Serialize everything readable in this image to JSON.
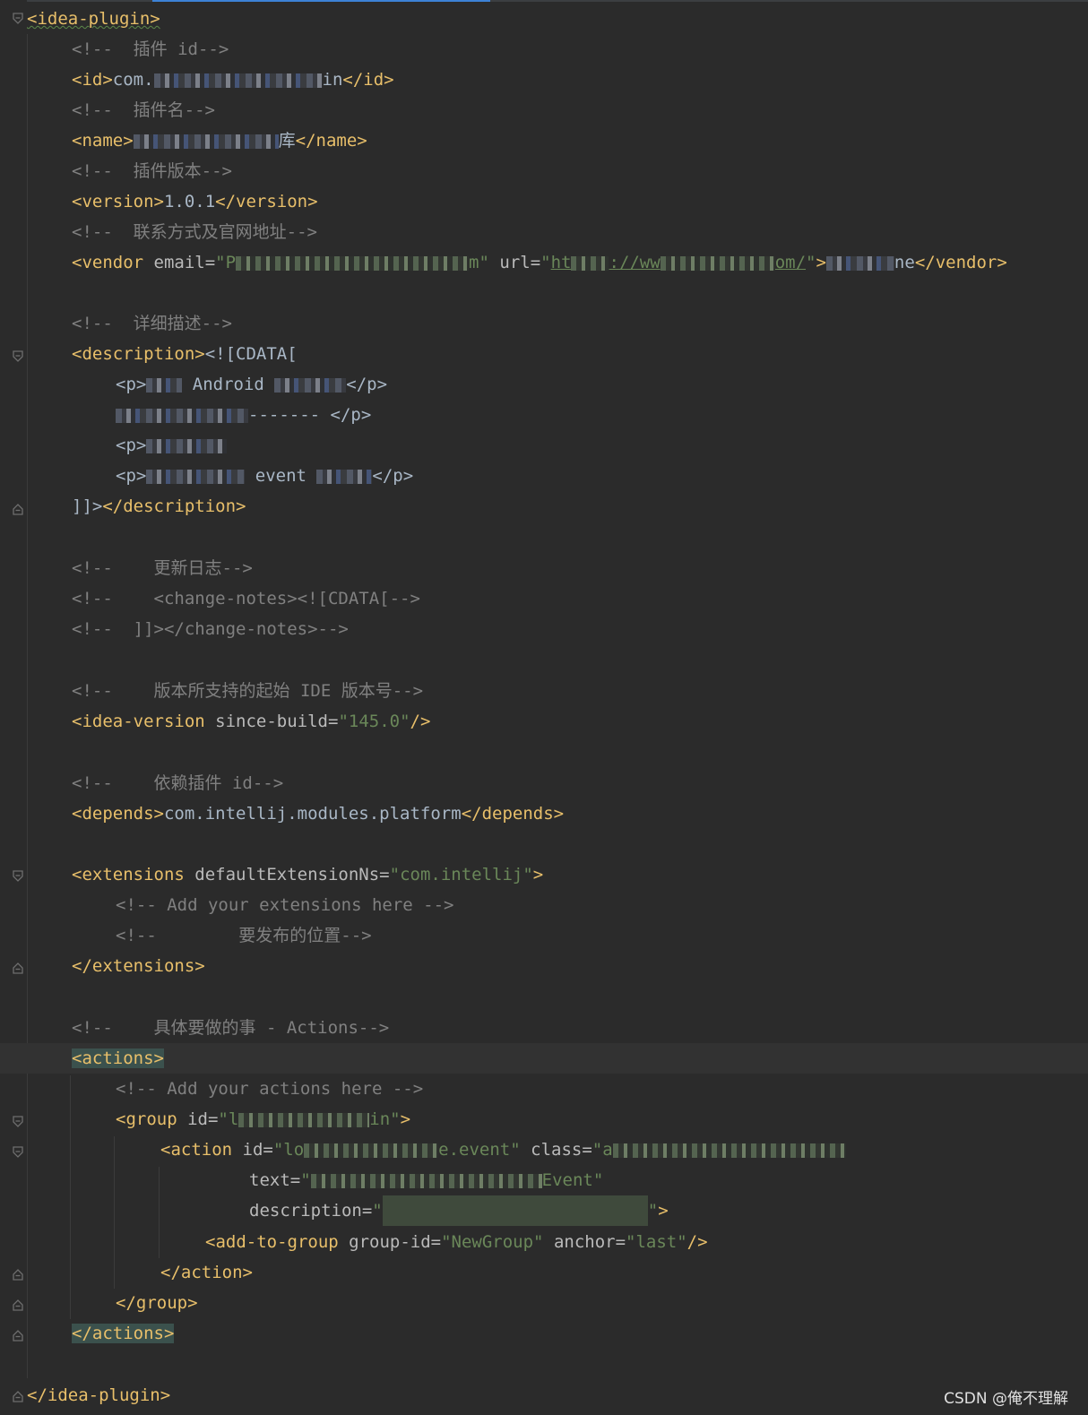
{
  "editor": {
    "root_open": "<idea-plugin>",
    "root_close": "</idea-plugin>",
    "c_id": "<!--  插件 id-->",
    "id_open": "<id>",
    "id_value_a": "com.",
    "id_value_b": "in",
    "id_close": "</id>",
    "c_name": "<!--  插件名-->",
    "name_open": "<name>",
    "name_value_b": "库",
    "name_close": "</name>",
    "c_version": "<!--  插件版本-->",
    "version_open": "<version>",
    "version_value": "1.0.1",
    "version_close": "</version>",
    "c_vendor": "<!--  联系方式及官网地址-->",
    "vendor_tag": "<vendor",
    "vendor_email_attr": " email=",
    "vendor_email_q1": "\"P",
    "vendor_email_q2": "m\"",
    "vendor_url_attr": " url=",
    "vendor_url_q1": "\"",
    "vendor_url_a": "ht",
    "vendor_url_b": "://ww",
    "vendor_url_c": "om/",
    "vendor_url_q2": "\"",
    "vendor_gt": ">",
    "vendor_text_b": "ne",
    "vendor_close": "</vendor>",
    "c_desc": "<!--  详细描述-->",
    "desc_open": "<description>",
    "cdata_open": "<![CDATA[",
    "p_open": "<p>",
    "p_close": "</p>",
    "desc_p1_text": " Android ",
    "desc_p2_text": "------- ",
    "desc_p2_close": "</p>",
    "desc_p4_text": " event ",
    "cdata_close": "]]>",
    "desc_close": "</description>",
    "c_changelog": "<!--    更新日志-->",
    "c_changenotes_open": "<!--    <change-notes><![CDATA[-->",
    "c_changenotes_close": "<!--  ]]></change-notes>-->",
    "c_ideaversion": "<!--    版本所支持的起始 IDE 版本号-->",
    "ideaversion_tag": "<idea-version",
    "ideaversion_attr": " since-build=",
    "ideaversion_value": "\"145.0\"",
    "ideaversion_end": "/>",
    "c_depends": "<!--    依赖插件 id-->",
    "depends_open": "<depends>",
    "depends_value": "com.intellij.modules.platform",
    "depends_close": "</depends>",
    "extensions_tag": "<extensions",
    "extensions_attr": " defaultExtensionNs=",
    "extensions_value": "\"com.intellij\"",
    "extensions_gt": ">",
    "c_add_ext": "<!-- Add your extensions here -->",
    "c_publish": "<!--        要发布的位置-->",
    "extensions_close": "</extensions>",
    "c_actions": "<!--    具体要做的事 - Actions-->",
    "actions_open": "<actions>",
    "c_add_actions": "<!-- Add your actions here -->",
    "group_tag": "<group",
    "group_id_attr": " id=",
    "group_id_q1": "\"l",
    "group_id_q2": "in\"",
    "group_gt": ">",
    "action_tag": "<action",
    "action_id_attr": " id=",
    "action_id_a": "\"lo",
    "action_id_b": "e.event\"",
    "action_class_attr": " class=",
    "action_class_q1": "\"a",
    "text_attr": "text=",
    "text_value_q1": "\"",
    "text_value_b": "Event\"",
    "description_attr": "description=",
    "description_q1": "\"",
    "description_q2": "\"",
    "description_gt": ">",
    "addtogroup_tag": "<add-to-group",
    "addtogroup_gid_attr": " group-id=",
    "addtogroup_gid_value": "\"NewGroup\"",
    "addtogroup_anchor_attr": " anchor=",
    "addtogroup_anchor_value": "\"last\"",
    "addtogroup_end": "/>",
    "action_close": "</action>",
    "group_close": "</group>",
    "actions_close": "</actions>"
  },
  "watermark": "CSDN @俺不理解",
  "colors": {
    "background": "#2b2b2b",
    "tag": "#e8bf6a",
    "attribute": "#bababa",
    "value": "#6a8759",
    "text": "#a9b7c6",
    "comment": "#808080",
    "highlight": "#3b514d",
    "tab_accent": "#3d82d6"
  }
}
